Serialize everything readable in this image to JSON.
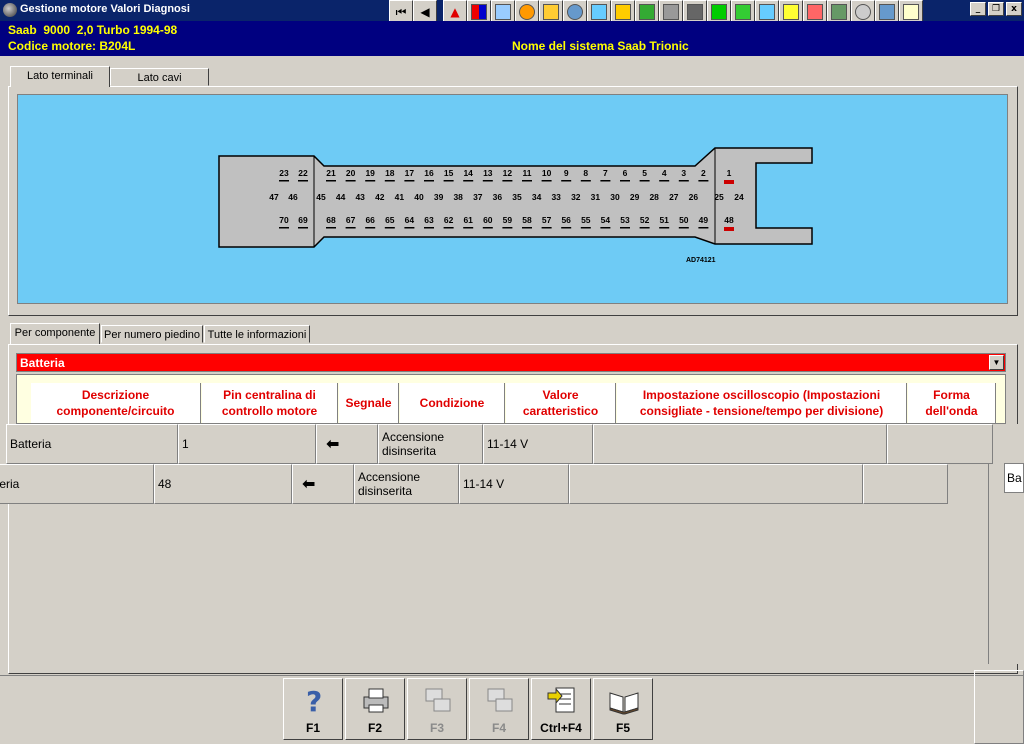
{
  "window": {
    "title": "Gestione motore Valori Diagnosi"
  },
  "toolbar": {
    "buttons": [
      "first-icon",
      "prev-icon",
      "warning-icon",
      "color-chart-icon",
      "wiring-icon",
      "component-icon",
      "sensor-icon",
      "gauge-icon",
      "tool-icon",
      "connector-icon",
      "fuse-icon",
      "settings-icon",
      "oil-icon",
      "pin-icon",
      "tank-icon",
      "engine-icon",
      "adjust-icon",
      "document-icon",
      "circuit-icon",
      "abs-icon",
      "car-icon",
      "notes-icon"
    ]
  },
  "window_controls": {
    "minimize": "_",
    "restore": "❐",
    "close": "x"
  },
  "vehicle": {
    "model": "Saab  9000  2,0 Turbo 1994-98",
    "engine_code": "Codice motore: B204L",
    "system": "Nome del sistema Saab Trionic"
  },
  "view_tabs": [
    {
      "label": "Lato terminali"
    },
    {
      "label": "Lato cavi"
    }
  ],
  "connector": {
    "code": "AD74121",
    "row_top": [
      "23",
      "22",
      "21",
      "20",
      "19",
      "18",
      "17",
      "16",
      "15",
      "14",
      "13",
      "12",
      "11",
      "10",
      "9",
      "8",
      "7",
      "6",
      "5",
      "4",
      "3",
      "2",
      "1"
    ],
    "row_mid": [
      "47",
      "46",
      "45",
      "44",
      "43",
      "42",
      "41",
      "40",
      "39",
      "38",
      "37",
      "36",
      "35",
      "34",
      "33",
      "32",
      "31",
      "30",
      "29",
      "28",
      "27",
      "26",
      "25",
      "24"
    ],
    "row_bot": [
      "70",
      "69",
      "68",
      "67",
      "66",
      "65",
      "64",
      "63",
      "62",
      "61",
      "60",
      "59",
      "58",
      "57",
      "56",
      "55",
      "54",
      "53",
      "52",
      "51",
      "50",
      "49",
      "48"
    ],
    "highlighted": [
      "1",
      "48"
    ],
    "colors": {
      "background": "#6ecbf5",
      "body": "#c0c0c0",
      "highlight": "#cc0000"
    }
  },
  "info_tabs": [
    {
      "label": "Per componente"
    },
    {
      "label": "Per numero piedino"
    },
    {
      "label": "Tutte le informazioni"
    }
  ],
  "component_select": {
    "value": "Batteria",
    "color": "#ff0000"
  },
  "table": {
    "headers": [
      "Descrizione componente/circuito",
      "Pin centralina di controllo motore",
      "Segnale",
      "Condizione",
      "Valore caratteristico",
      "Impostazione oscilloscopio (Impostazioni consigliate - tensione/tempo per divisione)",
      "Forma dell'onda"
    ],
    "rows": [
      {
        "component": "Batteria",
        "pin": "1",
        "signal": "arrow-left-icon",
        "condition": "Accensione disinserita",
        "value": "11-14 V",
        "scope": "",
        "waveform": ""
      },
      {
        "component": "atteria",
        "pin": "48",
        "signal": "arrow-left-icon",
        "condition": "Accensione disinserita",
        "value": "11-14 V",
        "scope": "",
        "waveform": ""
      }
    ],
    "partial_right": "Ba"
  },
  "fkeys": [
    {
      "label": "F1",
      "icon": "help-icon",
      "enabled": true
    },
    {
      "label": "F2",
      "icon": "print-icon",
      "enabled": true
    },
    {
      "label": "F3",
      "icon": "copy-icon",
      "enabled": false
    },
    {
      "label": "F4",
      "icon": "paste-icon",
      "enabled": false
    },
    {
      "label": "Ctrl+F4",
      "icon": "export-icon",
      "enabled": true
    },
    {
      "label": "F5",
      "icon": "book-icon",
      "enabled": true
    }
  ]
}
